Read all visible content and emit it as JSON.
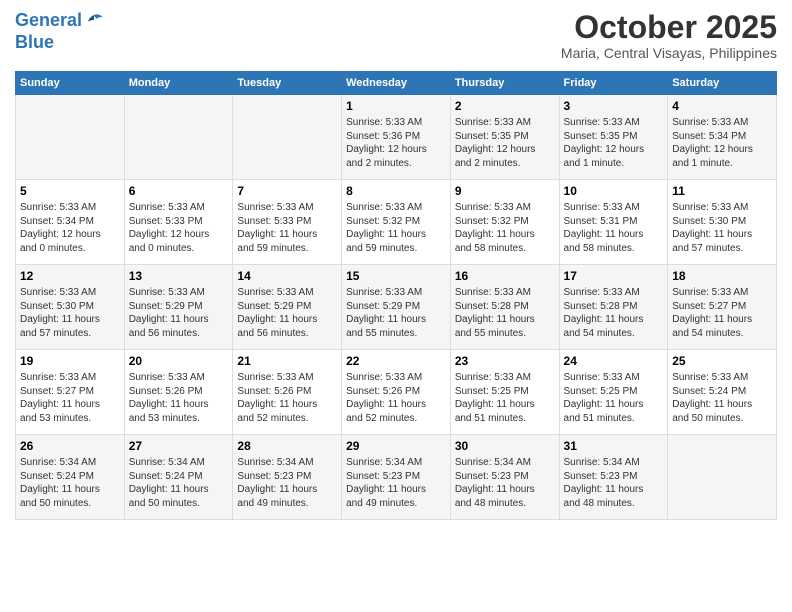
{
  "header": {
    "logo_line1": "General",
    "logo_line2": "Blue",
    "month_title": "October 2025",
    "location": "Maria, Central Visayas, Philippines"
  },
  "calendar": {
    "days_of_week": [
      "Sunday",
      "Monday",
      "Tuesday",
      "Wednesday",
      "Thursday",
      "Friday",
      "Saturday"
    ],
    "weeks": [
      {
        "row": 1,
        "days": [
          {
            "number": "",
            "info": ""
          },
          {
            "number": "",
            "info": ""
          },
          {
            "number": "",
            "info": ""
          },
          {
            "number": "1",
            "info": "Sunrise: 5:33 AM\nSunset: 5:36 PM\nDaylight: 12 hours\nand 2 minutes."
          },
          {
            "number": "2",
            "info": "Sunrise: 5:33 AM\nSunset: 5:35 PM\nDaylight: 12 hours\nand 2 minutes."
          },
          {
            "number": "3",
            "info": "Sunrise: 5:33 AM\nSunset: 5:35 PM\nDaylight: 12 hours\nand 1 minute."
          },
          {
            "number": "4",
            "info": "Sunrise: 5:33 AM\nSunset: 5:34 PM\nDaylight: 12 hours\nand 1 minute."
          }
        ]
      },
      {
        "row": 2,
        "days": [
          {
            "number": "5",
            "info": "Sunrise: 5:33 AM\nSunset: 5:34 PM\nDaylight: 12 hours\nand 0 minutes."
          },
          {
            "number": "6",
            "info": "Sunrise: 5:33 AM\nSunset: 5:33 PM\nDaylight: 12 hours\nand 0 minutes."
          },
          {
            "number": "7",
            "info": "Sunrise: 5:33 AM\nSunset: 5:33 PM\nDaylight: 11 hours\nand 59 minutes."
          },
          {
            "number": "8",
            "info": "Sunrise: 5:33 AM\nSunset: 5:32 PM\nDaylight: 11 hours\nand 59 minutes."
          },
          {
            "number": "9",
            "info": "Sunrise: 5:33 AM\nSunset: 5:32 PM\nDaylight: 11 hours\nand 58 minutes."
          },
          {
            "number": "10",
            "info": "Sunrise: 5:33 AM\nSunset: 5:31 PM\nDaylight: 11 hours\nand 58 minutes."
          },
          {
            "number": "11",
            "info": "Sunrise: 5:33 AM\nSunset: 5:30 PM\nDaylight: 11 hours\nand 57 minutes."
          }
        ]
      },
      {
        "row": 3,
        "days": [
          {
            "number": "12",
            "info": "Sunrise: 5:33 AM\nSunset: 5:30 PM\nDaylight: 11 hours\nand 57 minutes."
          },
          {
            "number": "13",
            "info": "Sunrise: 5:33 AM\nSunset: 5:29 PM\nDaylight: 11 hours\nand 56 minutes."
          },
          {
            "number": "14",
            "info": "Sunrise: 5:33 AM\nSunset: 5:29 PM\nDaylight: 11 hours\nand 56 minutes."
          },
          {
            "number": "15",
            "info": "Sunrise: 5:33 AM\nSunset: 5:29 PM\nDaylight: 11 hours\nand 55 minutes."
          },
          {
            "number": "16",
            "info": "Sunrise: 5:33 AM\nSunset: 5:28 PM\nDaylight: 11 hours\nand 55 minutes."
          },
          {
            "number": "17",
            "info": "Sunrise: 5:33 AM\nSunset: 5:28 PM\nDaylight: 11 hours\nand 54 minutes."
          },
          {
            "number": "18",
            "info": "Sunrise: 5:33 AM\nSunset: 5:27 PM\nDaylight: 11 hours\nand 54 minutes."
          }
        ]
      },
      {
        "row": 4,
        "days": [
          {
            "number": "19",
            "info": "Sunrise: 5:33 AM\nSunset: 5:27 PM\nDaylight: 11 hours\nand 53 minutes."
          },
          {
            "number": "20",
            "info": "Sunrise: 5:33 AM\nSunset: 5:26 PM\nDaylight: 11 hours\nand 53 minutes."
          },
          {
            "number": "21",
            "info": "Sunrise: 5:33 AM\nSunset: 5:26 PM\nDaylight: 11 hours\nand 52 minutes."
          },
          {
            "number": "22",
            "info": "Sunrise: 5:33 AM\nSunset: 5:26 PM\nDaylight: 11 hours\nand 52 minutes."
          },
          {
            "number": "23",
            "info": "Sunrise: 5:33 AM\nSunset: 5:25 PM\nDaylight: 11 hours\nand 51 minutes."
          },
          {
            "number": "24",
            "info": "Sunrise: 5:33 AM\nSunset: 5:25 PM\nDaylight: 11 hours\nand 51 minutes."
          },
          {
            "number": "25",
            "info": "Sunrise: 5:33 AM\nSunset: 5:24 PM\nDaylight: 11 hours\nand 50 minutes."
          }
        ]
      },
      {
        "row": 5,
        "days": [
          {
            "number": "26",
            "info": "Sunrise: 5:34 AM\nSunset: 5:24 PM\nDaylight: 11 hours\nand 50 minutes."
          },
          {
            "number": "27",
            "info": "Sunrise: 5:34 AM\nSunset: 5:24 PM\nDaylight: 11 hours\nand 50 minutes."
          },
          {
            "number": "28",
            "info": "Sunrise: 5:34 AM\nSunset: 5:23 PM\nDaylight: 11 hours\nand 49 minutes."
          },
          {
            "number": "29",
            "info": "Sunrise: 5:34 AM\nSunset: 5:23 PM\nDaylight: 11 hours\nand 49 minutes."
          },
          {
            "number": "30",
            "info": "Sunrise: 5:34 AM\nSunset: 5:23 PM\nDaylight: 11 hours\nand 48 minutes."
          },
          {
            "number": "31",
            "info": "Sunrise: 5:34 AM\nSunset: 5:23 PM\nDaylight: 11 hours\nand 48 minutes."
          },
          {
            "number": "",
            "info": ""
          }
        ]
      }
    ]
  }
}
